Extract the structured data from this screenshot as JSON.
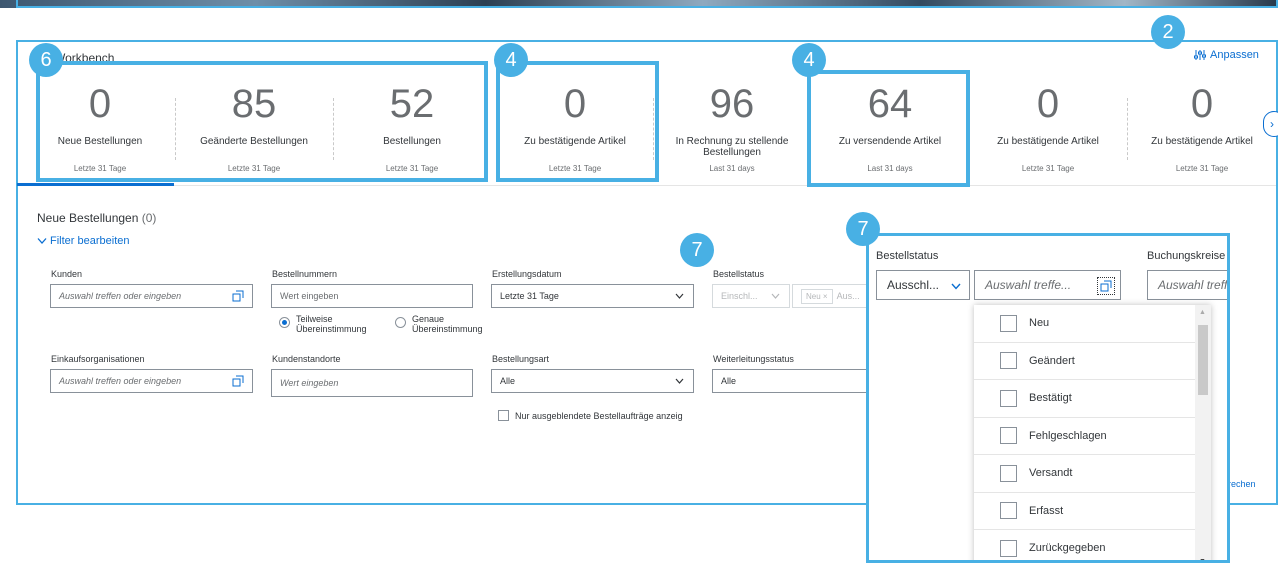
{
  "workbench": {
    "title": "Workbench",
    "customize_label": "Anpassen",
    "tiles": [
      {
        "value": "0",
        "label": "Neue Bestellungen",
        "period": "Letzte 31 Tage"
      },
      {
        "value": "85",
        "label": "Geänderte Bestellungen",
        "period": "Letzte 31 Tage"
      },
      {
        "value": "52",
        "label": "Bestellungen",
        "period": "Letzte 31 Tage"
      },
      {
        "value": "0",
        "label": "Zu bestätigende Artikel",
        "period": "Letzte 31 Tage"
      },
      {
        "value": "96",
        "label": "In Rechnung zu stellende Bestellungen",
        "period": "Last 31 days"
      },
      {
        "value": "64",
        "label": "Zu versendende Artikel",
        "period": "Last 31 days"
      },
      {
        "value": "0",
        "label": "Zu bestätigende Artikel",
        "period": "Letzte 31 Tage"
      },
      {
        "value": "0",
        "label": "Zu bestätigende Artikel",
        "period": "Letzte 31 Tage"
      }
    ],
    "next_arrow": "›"
  },
  "callouts": {
    "b6": "6",
    "b4a": "4",
    "b4b": "4",
    "b2": "2",
    "b7a": "7",
    "b7b": "7"
  },
  "section": {
    "title": "Neue Bestellungen",
    "count": "(0)",
    "filter_link": "Filter bearbeiten",
    "more_link": "rechen"
  },
  "filters": {
    "customers": {
      "label": "Kunden",
      "placeholder": "Auswahl treffen oder eingeben"
    },
    "order_numbers": {
      "label": "Bestellnummern",
      "placeholder": "Wert eingeben"
    },
    "match_partial": "Teilweise Übereinstimmung",
    "match_exact": "Genaue Übereinstimmung",
    "created_date": {
      "label": "Erstellungsdatum",
      "value": "Letzte 31 Tage"
    },
    "order_status": {
      "label": "Bestellstatus",
      "mode": "Einschl...",
      "token": "Neu",
      "more": "Aus..."
    },
    "purchasing_orgs": {
      "label": "Einkaufsorganisationen",
      "placeholder": "Auswahl treffen oder eingeben"
    },
    "customer_sites": {
      "label": "Kundenstandorte",
      "placeholder": "Wert eingeben"
    },
    "order_type": {
      "label": "Bestellungsart",
      "value": "Alle"
    },
    "forwarding_status": {
      "label": "Weiterleitungsstatus",
      "value": "Alle"
    },
    "hidden_only": "Nur ausgeblendete Bestellaufträge anzeig"
  },
  "zoom": {
    "status_label": "Bestellstatus",
    "company_label": "Buchungskreise",
    "mode_value": "Ausschl...",
    "select_placeholder": "Auswahl treffe...",
    "company_placeholder": "Auswahl treffe",
    "options": [
      "Neu",
      "Geändert",
      "Bestätigt",
      "Fehlgeschlagen",
      "Versandt",
      "Erfasst",
      "Zurückgegeben"
    ]
  },
  "colors": {
    "accent": "#0a6ed1",
    "callout": "#48b0e4"
  }
}
